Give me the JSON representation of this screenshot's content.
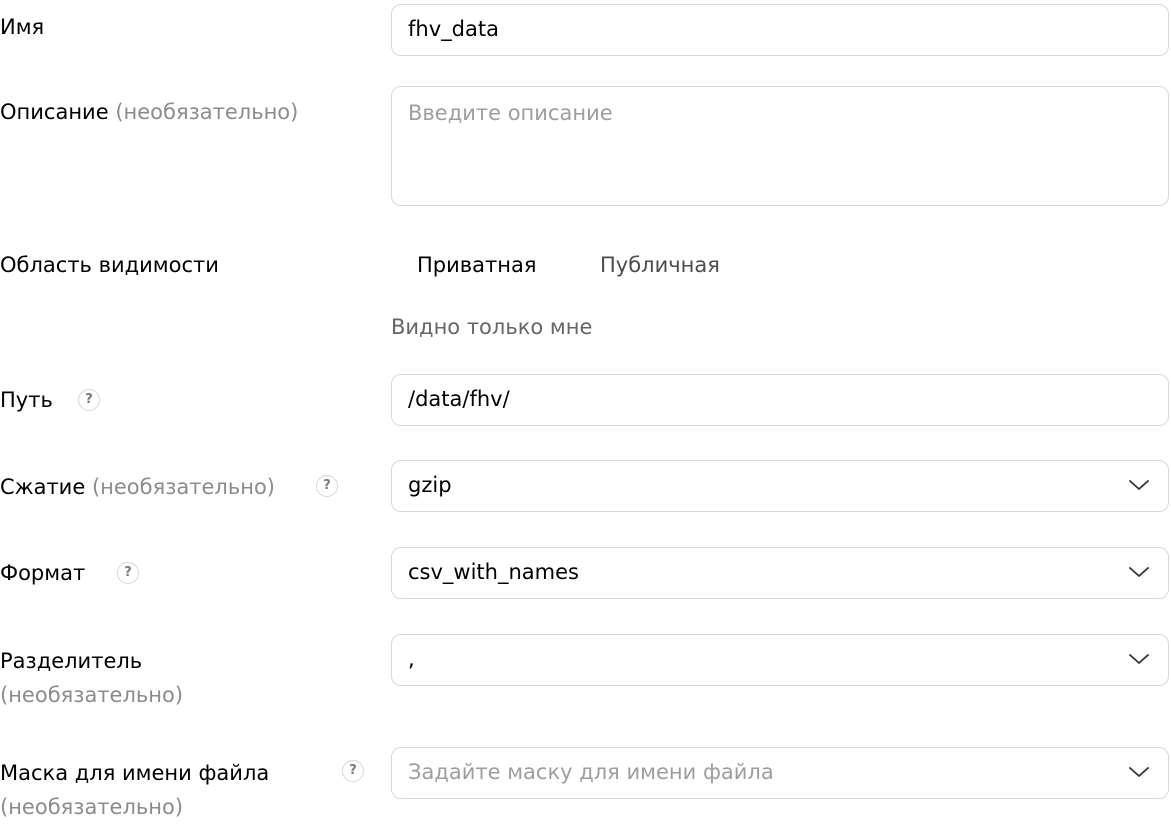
{
  "form": {
    "name": {
      "label": "Имя",
      "value": "fhv_data"
    },
    "description": {
      "label": "Описание",
      "optional": "(необязательно)",
      "placeholder": "Введите описание"
    },
    "visibility": {
      "label": "Область видимости",
      "options": [
        "Приватная",
        "Публичная"
      ],
      "selected": "Приватная",
      "hint": "Видно только мне"
    },
    "path": {
      "label": "Путь",
      "value": "/data/fhv/"
    },
    "compression": {
      "label": "Сжатие",
      "optional": "(необязательно)",
      "value": "gzip"
    },
    "format": {
      "label": "Формат",
      "value": "csv_with_names"
    },
    "delimiter": {
      "label": "Разделитель",
      "optional": "(необязательно)",
      "value": ","
    },
    "file_mask": {
      "label": "Маска для имени файла",
      "optional": "(необязательно)",
      "placeholder": "Задайте маску для имени файла"
    },
    "help_symbol": "?"
  },
  "colors": {
    "border": "#d9d9d9",
    "optional_text": "#8c8c8c",
    "placeholder": "#9e9e9e",
    "hint": "#666666"
  }
}
